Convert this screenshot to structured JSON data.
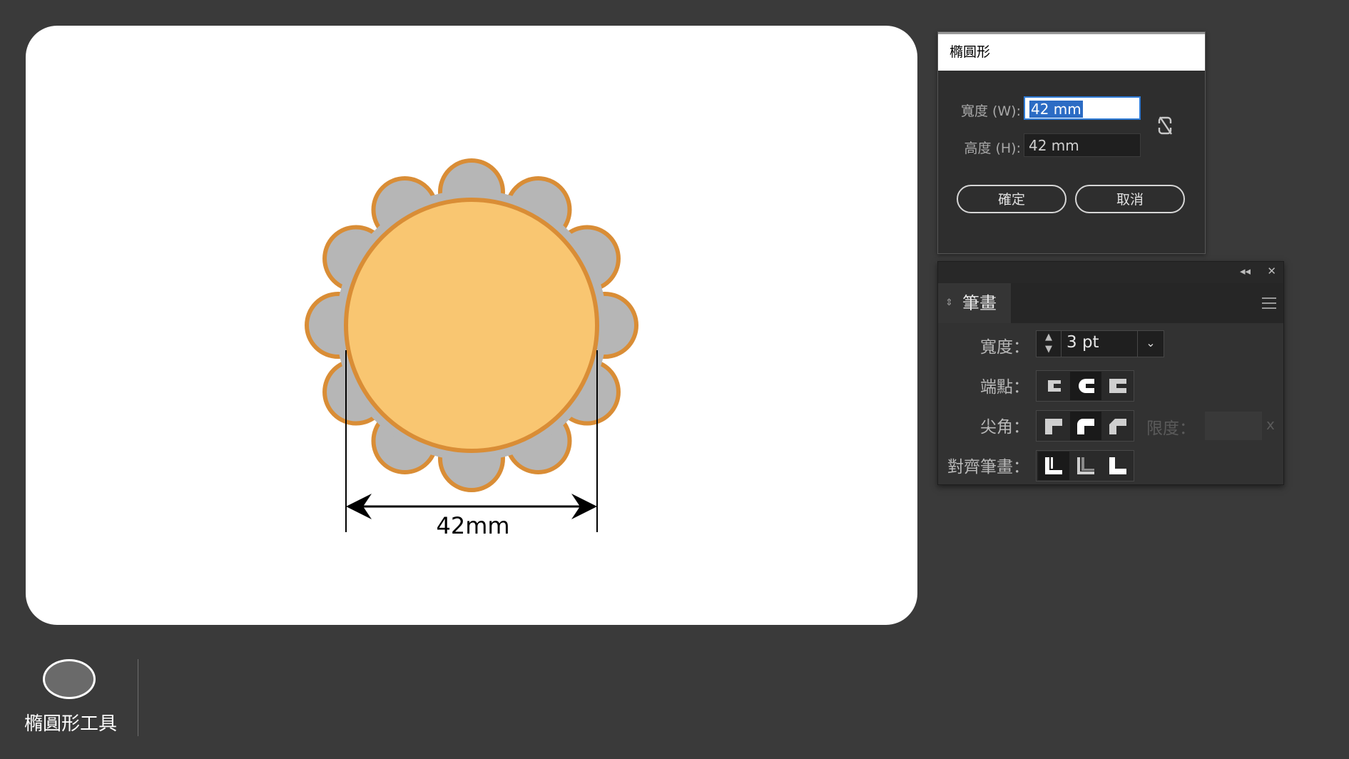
{
  "artboard": {
    "dimension_label": "42mm",
    "colors": {
      "inner_fill": "#f9c671",
      "outer_fill": "#b6b6b6",
      "stroke": "#d98d36"
    }
  },
  "ellipse_dialog": {
    "title": "橢圓形",
    "width_label": "寬度 (W):",
    "width_value": "42 mm",
    "height_label": "高度 (H):",
    "height_value": "42 mm",
    "ok_label": "確定",
    "cancel_label": "取消"
  },
  "stroke_panel": {
    "tab_label": "筆畫",
    "width_label": "寬度：",
    "width_value": "3 pt",
    "cap_label": "端點：",
    "corner_label": "尖角：",
    "limit_label": "限度：",
    "limit_suffix": "x",
    "align_label": "對齊筆畫："
  },
  "tool": {
    "label": "橢圓形工具"
  }
}
